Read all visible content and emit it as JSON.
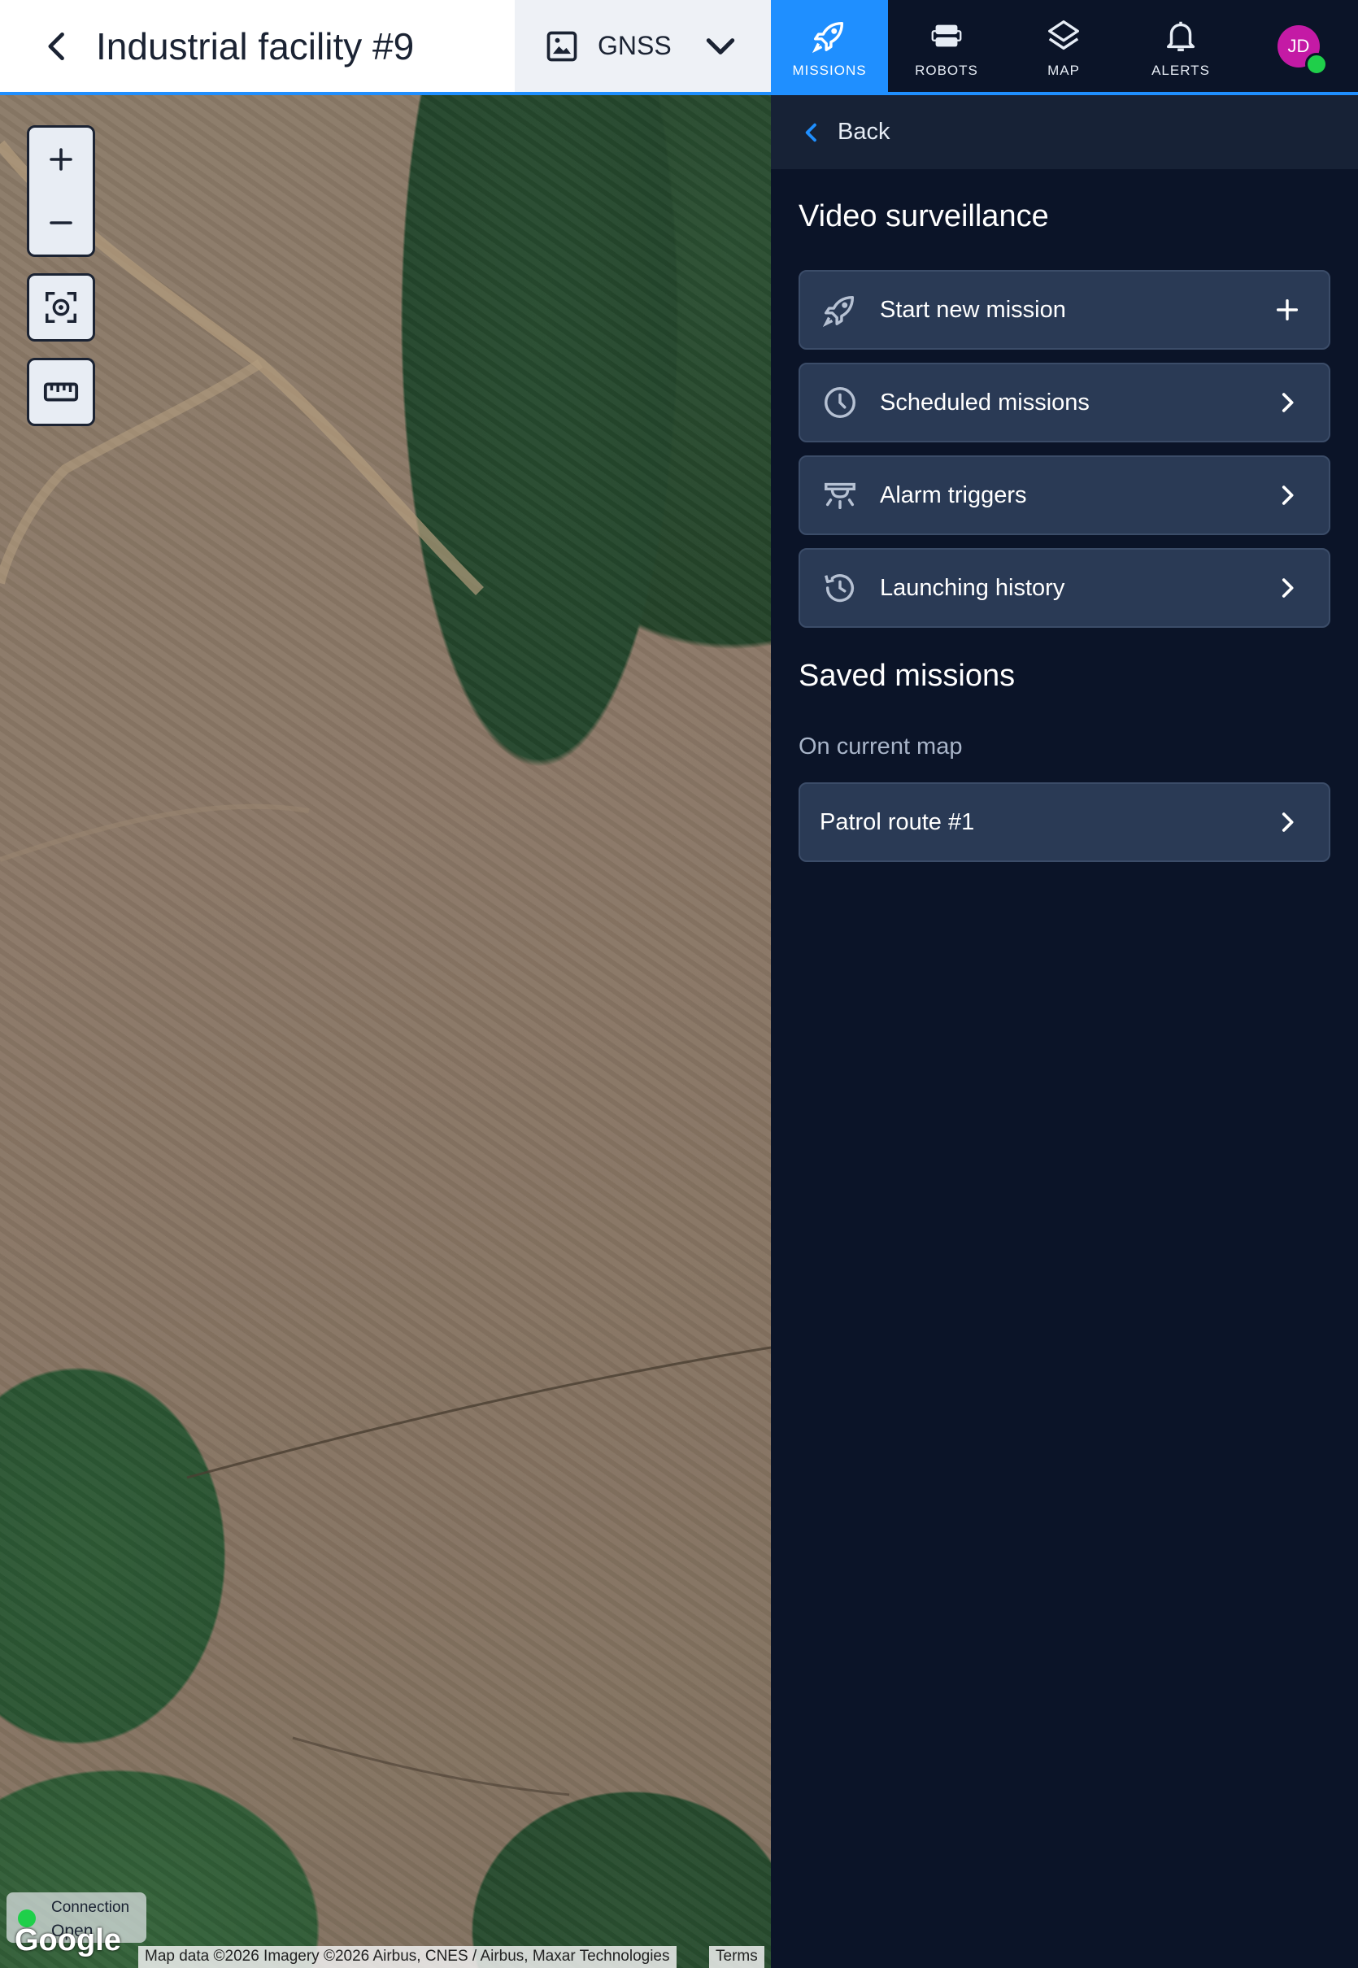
{
  "header": {
    "title": "Industrial facility #9",
    "positioning_mode": "GNSS"
  },
  "nav": {
    "items": [
      {
        "label": "MISSIONS",
        "icon": "rocket-icon",
        "active": true
      },
      {
        "label": "ROBOTS",
        "icon": "robot-icon",
        "active": false
      },
      {
        "label": "MAP",
        "icon": "layers-icon",
        "active": false
      },
      {
        "label": "ALERTS",
        "icon": "bell-icon",
        "active": false
      }
    ],
    "user_initials": "JD"
  },
  "panel": {
    "back_label": "Back",
    "section_title": "Video surveillance",
    "actions": [
      {
        "label": "Start new mission",
        "icon": "rocket-icon",
        "trail": "plus-icon"
      },
      {
        "label": "Scheduled missions",
        "icon": "clock-icon",
        "trail": "chevron-right-icon"
      },
      {
        "label": "Alarm triggers",
        "icon": "alarm-icon",
        "trail": "chevron-right-icon"
      },
      {
        "label": "Launching history",
        "icon": "history-icon",
        "trail": "chevron-right-icon"
      }
    ],
    "saved_title": "Saved missions",
    "saved_group": "On current map",
    "saved_items": [
      {
        "label": "Patrol route #1"
      }
    ]
  },
  "map": {
    "connection_label": "Connection",
    "connection_value": "Open",
    "logo": "Google",
    "attribution": "Map data ©2026 Imagery ©2026 Airbus, CNES / Airbus, Maxar Technologies",
    "terms": "Terms"
  },
  "colors": {
    "accent": "#1f8fff",
    "panel_bg": "#0b1428",
    "row_bg": "#2a3a55",
    "avatar": "#c41aa5",
    "status_online": "#1fcf4a"
  }
}
